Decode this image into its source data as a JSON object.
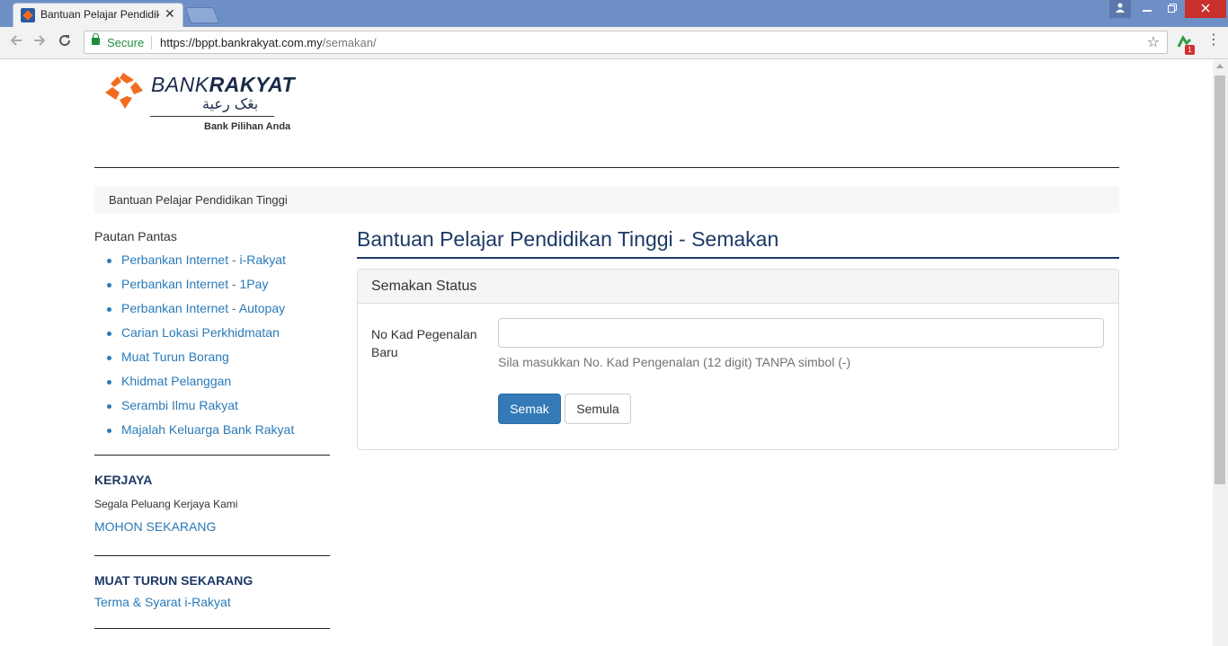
{
  "browser": {
    "tab_title": "Bantuan Pelajar Pendidikan Tinggi",
    "tab_close": "✕",
    "secure_label": "Secure",
    "url_base": "https://bppt.bankrakyat.com.my",
    "url_path": "/semakan/",
    "extension_badge": "1"
  },
  "logo": {
    "bank": "BANK",
    "rakyat": "RAKYAT",
    "arabic": "بڠک رعية",
    "tagline": "Bank Pilihan Anda"
  },
  "breadcrumb": "Bantuan Pelajar Pendidikan Tinggi",
  "sidebar": {
    "quick_title": "Pautan Pantas",
    "quick_links": [
      "Perbankan Internet - i-Rakyat",
      "Perbankan Internet - 1Pay",
      "Perbankan Internet - Autopay",
      "Carian Lokasi Perkhidmatan",
      "Muat Turun Borang",
      "Khidmat Pelanggan",
      "Serambi Ilmu Rakyat",
      "Majalah Keluarga Bank Rakyat"
    ],
    "career": {
      "heading": "KERJAYA",
      "text": "Segala Peluang Kerjaya Kami",
      "link": "MOHON SEKARANG"
    },
    "download": {
      "heading": "MUAT TURUN SEKARANG",
      "link": "Terma & Syarat i-Rakyat"
    }
  },
  "main": {
    "title": "Bantuan Pelajar Pendidikan Tinggi - Semakan",
    "panel_title": "Semakan Status",
    "field_label": "No Kad Pegenalan Baru",
    "input_value": "",
    "help_text": "Sila masukkan No. Kad Pengenalan (12 digit) TANPA simbol (-)",
    "submit_label": "Semak",
    "reset_label": "Semula"
  },
  "colors": {
    "link": "#2a7ab8",
    "heading": "#1d3966",
    "primary_button": "#337ab7"
  }
}
